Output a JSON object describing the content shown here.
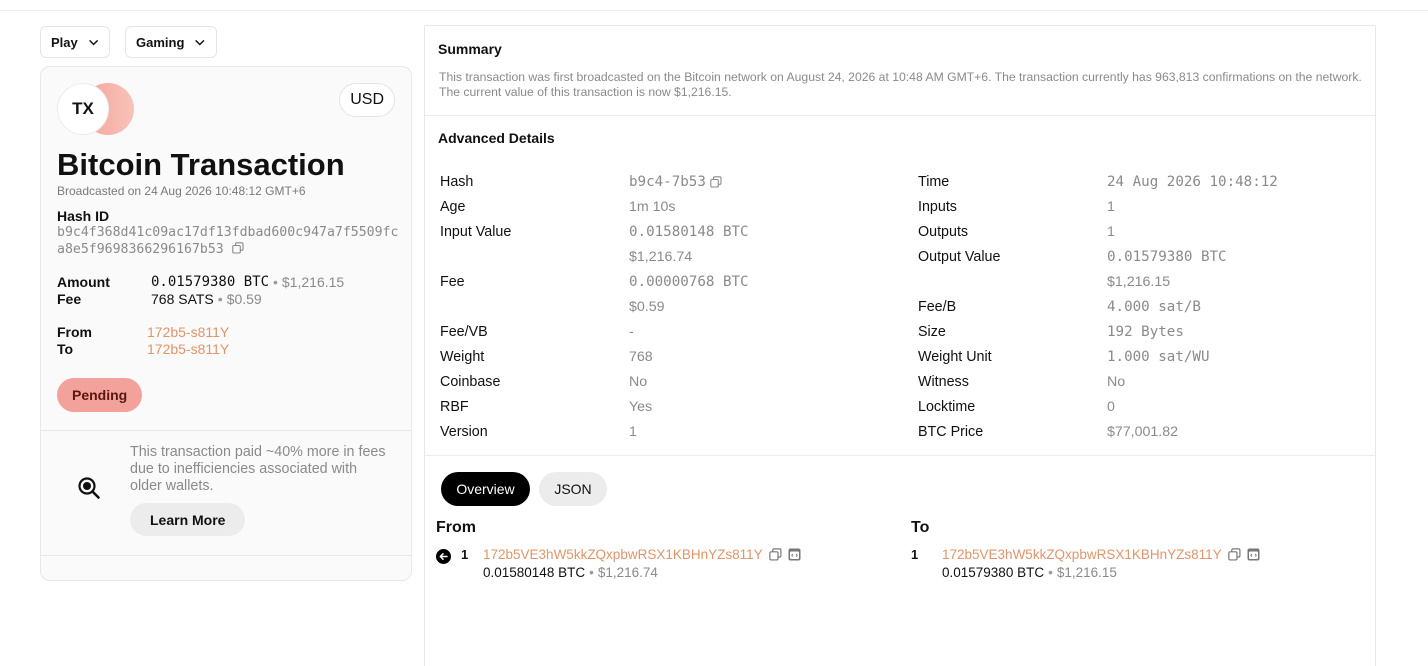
{
  "filters": {
    "play_label": "Play",
    "gaming_label": "Gaming"
  },
  "card": {
    "logo_text": "TX",
    "currency": "USD",
    "title": "Bitcoin Transaction",
    "broadcast": "Broadcasted on 24 Aug 2026 10:48:12 GMT+6",
    "hash_label": "Hash ID",
    "hash_value": "b9c4f368d41c09ac17df13fdbad600c947a7f5509fca8e5f9698366296167b53",
    "amount_label": "Amount",
    "amount_value": "0.01579380 BTC",
    "amount_usd": "$1,216.15",
    "fee_label": "Fee",
    "fee_value": "768 SATS",
    "fee_usd": "$0.59",
    "from_label": "From",
    "from_value": "172b5-s811Y",
    "to_label": "To",
    "to_value": "172b5-s811Y",
    "status": "Pending",
    "note": "This transaction paid ~40% more in fees due to inefficiencies associated with older wallets.",
    "learn_more": "Learn More",
    "separator": "•"
  },
  "summary": {
    "title": "Summary",
    "text": "This transaction was first broadcasted on the Bitcoin network on August 24, 2026 at 10:48 AM GMT+6. The transaction currently has 963,813 confirmations on the network. The current value of this transaction is now $1,216.15."
  },
  "advanced": {
    "title": "Advanced Details",
    "left": [
      {
        "label": "Hash",
        "value": "b9c4-7b53"
      },
      {
        "label": "Age",
        "value": "1m 10s"
      },
      {
        "label": "Input Value",
        "value": "0.01580148 BTC"
      },
      {
        "label": "",
        "value": "$1,216.74"
      },
      {
        "label": "Fee",
        "value": "0.00000768 BTC"
      },
      {
        "label": "",
        "value": "$0.59"
      },
      {
        "label": "Fee/VB",
        "value": "-"
      },
      {
        "label": "Weight",
        "value": "768"
      },
      {
        "label": "Coinbase",
        "value": "No"
      },
      {
        "label": "RBF",
        "value": "Yes"
      },
      {
        "label": "Version",
        "value": "1"
      }
    ],
    "right": [
      {
        "label": "Time",
        "value": "24 Aug 2026 10:48:12"
      },
      {
        "label": "Inputs",
        "value": "1"
      },
      {
        "label": "Outputs",
        "value": "1"
      },
      {
        "label": "Output Value",
        "value": "0.01579380 BTC"
      },
      {
        "label": "",
        "value": "$1,216.15"
      },
      {
        "label": "Fee/B",
        "value": "4.000 sat/B"
      },
      {
        "label": "Size",
        "value": "192 Bytes"
      },
      {
        "label": "Weight Unit",
        "value": "1.000 sat/WU"
      },
      {
        "label": "Witness",
        "value": "No"
      },
      {
        "label": "Locktime",
        "value": "0"
      },
      {
        "label": "BTC Price",
        "value": "$77,001.82"
      }
    ]
  },
  "tabs": {
    "overview": "Overview",
    "json": "JSON"
  },
  "io": {
    "from_title": "From",
    "to_title": "To",
    "input": {
      "index": "1",
      "address": "172b5VE3hW5kkZQxpbwRSX1KBHnYZs811Y",
      "amount": "0.01580148 BTC",
      "usd": "$1,216.74"
    },
    "output": {
      "index": "1",
      "address": "172b5VE3hW5kkZQxpbwRSX1KBHnYZs811Y",
      "amount": "0.01579380 BTC",
      "usd": "$1,216.15"
    }
  }
}
